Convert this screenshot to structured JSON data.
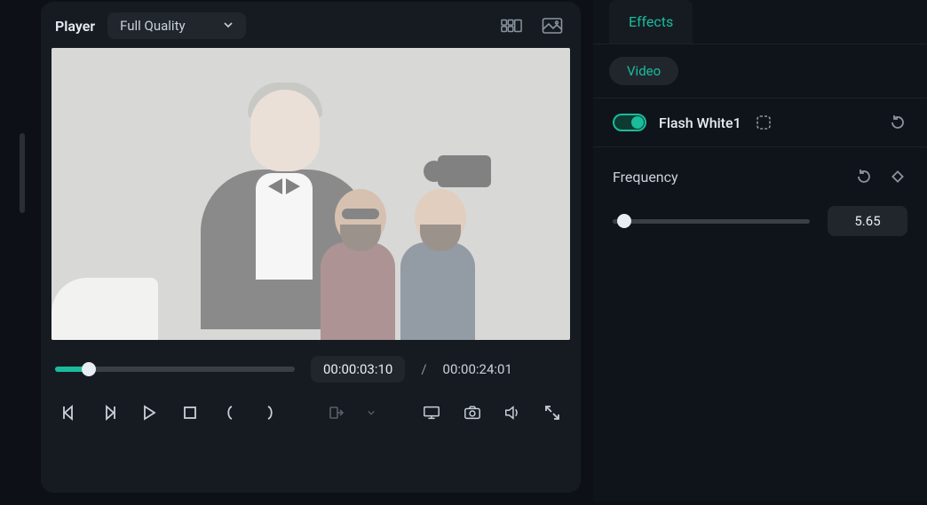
{
  "player": {
    "title": "Player",
    "quality_label": "Full Quality",
    "time_current": "00:00:03:10",
    "time_total": "00:00:24:01",
    "progress_pct": 14
  },
  "effects": {
    "tab_label": "Effects",
    "subtab_label": "Video",
    "active_effect": {
      "name": "Flash White1",
      "enabled": true
    },
    "params": {
      "frequency": {
        "label": "Frequency",
        "value": "5.65",
        "slider_pct": 6
      }
    }
  },
  "icons": {
    "layout_grid": "layout-grid-icon",
    "snapshot_image": "image-icon",
    "prev_frame": "prev-frame-icon",
    "next_frame": "next-frame-icon",
    "play": "play-icon",
    "stop": "stop-icon",
    "marker_in": "marker-in-icon",
    "marker_out": "marker-out-icon",
    "marker_menu": "marker-menu-icon",
    "display": "display-icon",
    "camera": "camera-icon",
    "volume": "volume-icon",
    "fullscreen": "fullscreen-icon",
    "crop": "crop-icon",
    "reset": "reset-icon",
    "keyframe": "keyframe-icon",
    "param_reset": "reset-icon"
  }
}
